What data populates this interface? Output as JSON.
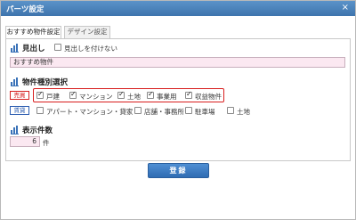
{
  "window": {
    "title": "パーツ設定",
    "close_glyph": "×"
  },
  "tabs": [
    {
      "label": "おすすめ物件設定",
      "active": true
    },
    {
      "label": "デザイン設定",
      "active": false
    }
  ],
  "heading_section": {
    "title": "見出し",
    "hide_checkbox_label": "見出しを付けない",
    "hide_checked": false,
    "value": "おすすめ物件"
  },
  "property_section": {
    "title": "物件種別選択",
    "sale": {
      "badge": "売買",
      "options": [
        {
          "label": "戸建",
          "checked": true
        },
        {
          "label": "マンション",
          "checked": true
        },
        {
          "label": "土地",
          "checked": true
        },
        {
          "label": "事業用",
          "checked": true
        },
        {
          "label": "収益物件",
          "checked": true
        }
      ]
    },
    "rent": {
      "badge": "賃貸",
      "options": [
        {
          "label": "アパート・マンション・貸家",
          "checked": false
        },
        {
          "label": "店舗・事務所",
          "checked": false
        },
        {
          "label": "駐車場",
          "checked": false
        },
        {
          "label": "土地",
          "checked": false
        }
      ]
    }
  },
  "count_section": {
    "title": "表示件数",
    "value": "6",
    "unit": "件"
  },
  "submit_label": "登録",
  "colors": {
    "titlebar": "#3e74ad",
    "sale_accent": "#d62020",
    "rent_accent": "#2c5db0",
    "input_bg": "#fbe8f1",
    "button": "#2f6cb3"
  }
}
